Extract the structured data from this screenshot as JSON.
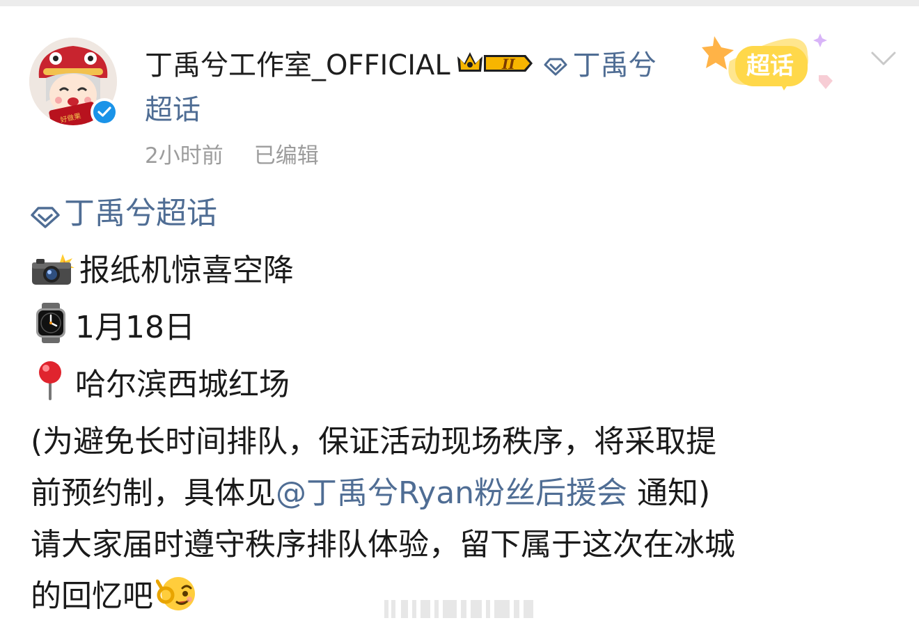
{
  "post": {
    "author": "丁禹兮工作室_OFFICIAL",
    "level_badge": "II",
    "header_topic": "丁禹兮超话",
    "time": "2小时前",
    "edited": "已编辑",
    "chaohua_label": "超话",
    "avatar_text": "好做果",
    "topic": "丁禹兮超话",
    "lines": {
      "line1": "报纸机惊喜空降",
      "line2": "1月18日",
      "line3": "哈尔滨西城红场",
      "line4a": "(为避免长时间排队，保证活动现场秩序，将采取提",
      "line5_pre": "前预约制，具体见",
      "mention": "@丁禹兮Ryan粉丝后援会",
      "line5_post": " 通知)",
      "line6": "请大家届时遵守秩序排队体验，留下属于这次在冰城",
      "line7": "的回忆吧"
    }
  },
  "icons": {
    "camera": "camera-flash-icon",
    "watch": "watch-icon",
    "pin": "pushpin-icon",
    "diamond": "diamond-topic-icon",
    "emoji": "wink-ok-emoji"
  },
  "colors": {
    "link": "#4f6d94",
    "meta": "#9c9c9c",
    "verified": "#1a93e8",
    "badge_gold": "#f7b500"
  }
}
